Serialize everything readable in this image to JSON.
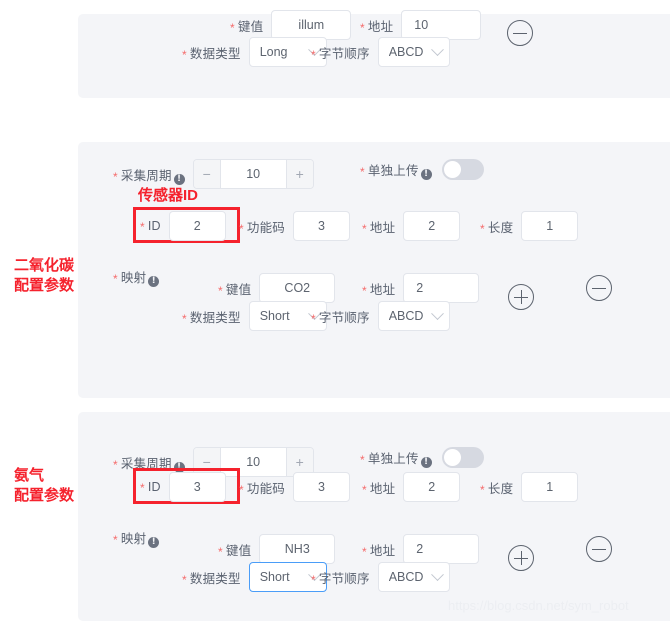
{
  "page": {
    "watermark": "https://blog.csdn.net/sym_robot",
    "colors": {
      "panel_bg": "#f4f5f8",
      "page_bg": "#ffffff",
      "annotation_red": "#f5222d",
      "required_red": "#f56c6c",
      "focus_blue": "#4a9df8",
      "label_gray": "#5a6270"
    }
  },
  "labels": {
    "key_value": "键值",
    "address": "地址",
    "data_type": "数据类型",
    "byte_order": "字节顺序",
    "collect_period": "采集周期",
    "separate_upload": "单独上传",
    "id": "ID",
    "function_code": "功能码",
    "length": "长度",
    "mapping": "映射",
    "required_mark": "*",
    "info_mark": "!"
  },
  "annotations": {
    "sensor_id": "传感器ID",
    "co2_config_line1": "二氧化碳",
    "co2_config_line2": "配置参数",
    "nh3_config_line1": "氨气",
    "nh3_config_line2": "配置参数"
  },
  "panels": [
    {
      "name": "illum-mapping-partial",
      "mapping": {
        "key_value": "illum",
        "address": "10",
        "data_type": "Long",
        "byte_order": "ABCD"
      },
      "remove_button": "−"
    },
    {
      "name": "co2-config",
      "collect_period": {
        "value": "10",
        "minus": "−",
        "plus": "+"
      },
      "separate_upload": {
        "state": "off"
      },
      "device": {
        "id": "2",
        "function_code": "3",
        "address": "2",
        "length": "1"
      },
      "mapping": {
        "key_value": "CO2",
        "address": "2",
        "data_type": "Short",
        "byte_order": "ABCD"
      },
      "add_button": "+",
      "remove_button": "−"
    },
    {
      "name": "nh3-config",
      "collect_period": {
        "value": "10",
        "minus": "−",
        "plus": "+"
      },
      "separate_upload": {
        "state": "off"
      },
      "device": {
        "id": "3",
        "function_code": "3",
        "address": "2",
        "length": "1"
      },
      "mapping": {
        "key_value": "NH3",
        "address": "2",
        "data_type": "Short",
        "byte_order": "ABCD"
      },
      "add_button": "+",
      "remove_button": "−"
    }
  ]
}
